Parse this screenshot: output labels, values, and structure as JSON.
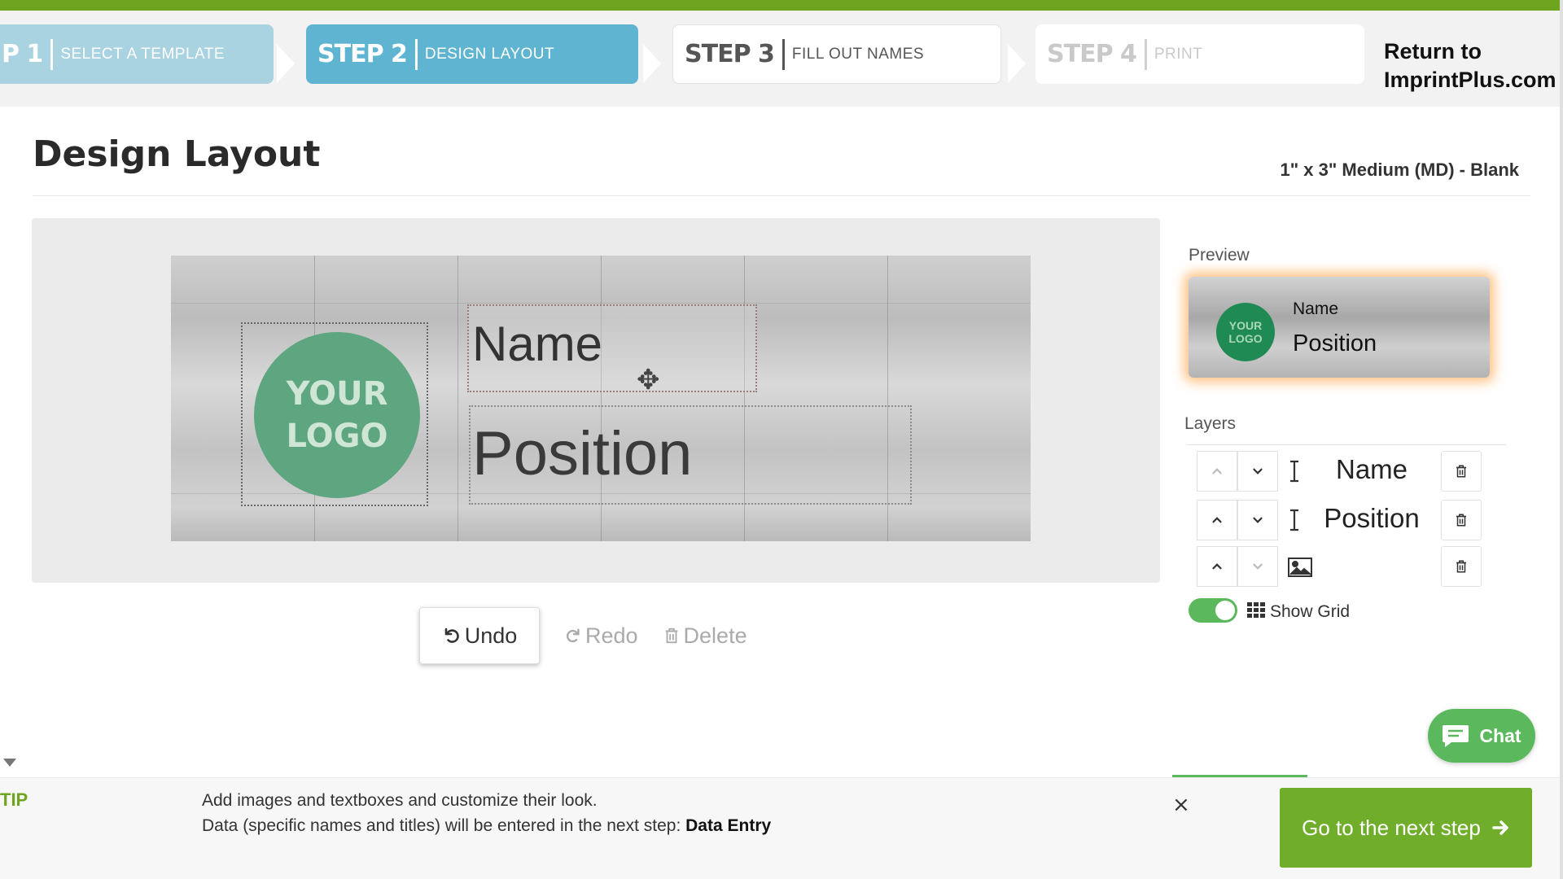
{
  "steps": [
    {
      "num": "P 1",
      "label": "SELECT A TEMPLATE",
      "state": "done"
    },
    {
      "num": "STEP 2",
      "label": "DESIGN LAYOUT",
      "state": "active"
    },
    {
      "num": "STEP 3",
      "label": "FILL OUT NAMES",
      "state": "upcoming"
    },
    {
      "num": "STEP 4",
      "label": "PRINT",
      "state": "disabled"
    }
  ],
  "header": {
    "return_line1": "Return to",
    "return_line2": "ImprintPlus.com"
  },
  "page": {
    "title": "Design Layout",
    "product": "1\" x 3\" Medium (MD) - Blank"
  },
  "canvas": {
    "logo_line1": "YOUR",
    "logo_line2": "LOGO",
    "name_text": "Name",
    "position_text": "Position"
  },
  "actions": {
    "undo": "Undo",
    "redo": "Redo",
    "delete": "Delete"
  },
  "preview": {
    "label": "Preview",
    "logo_line1": "YOUR",
    "logo_line2": "LOGO",
    "name": "Name",
    "position": "Position",
    "glow_color": "#ff9628"
  },
  "layers": {
    "label": "Layers",
    "items": [
      {
        "type": "text",
        "text": "Name"
      },
      {
        "type": "text",
        "text": "Position"
      },
      {
        "type": "image",
        "text": ""
      }
    ]
  },
  "grid": {
    "label": "Show Grid",
    "enabled": true
  },
  "chat": {
    "label": "Chat"
  },
  "tip": {
    "label": "TIP",
    "line1": "Add images and textboxes and customize their look.",
    "line2_prefix": "Data (specific names and titles) will be entered in the next step: ",
    "line2_bold": "Data Entry",
    "close": "×"
  },
  "next_button": {
    "label": "Go to the next step"
  },
  "colors": {
    "brand_green": "#6fa41e",
    "step_active": "#5fb5d1",
    "step_done": "#a9d3e0",
    "logo_green": "#5da67f",
    "button_green": "#6fad2b"
  }
}
